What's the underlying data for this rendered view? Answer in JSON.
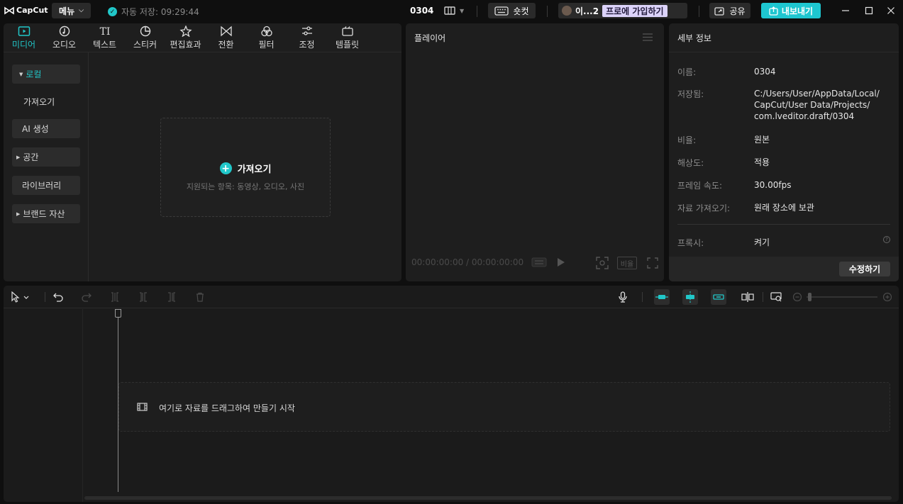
{
  "app": {
    "logo": "CapCut",
    "menu_label": "메뉴",
    "autosave": "자동 저장: 09:29:44",
    "project_name": "0304"
  },
  "titlebar": {
    "shortcut_label": "숏컷",
    "user_label": "이...2",
    "pro_label": "프로에 가입하기",
    "share_label": "공유",
    "export_label": "내보내기"
  },
  "tabs": [
    {
      "label": "미디어",
      "icon": "media-icon"
    },
    {
      "label": "오디오",
      "icon": "audio-icon"
    },
    {
      "label": "텍스트",
      "icon": "text-icon"
    },
    {
      "label": "스티커",
      "icon": "sticker-icon"
    },
    {
      "label": "편집효과",
      "icon": "effects-icon"
    },
    {
      "label": "전환",
      "icon": "transition-icon"
    },
    {
      "label": "필터",
      "icon": "filter-icon"
    },
    {
      "label": "조정",
      "icon": "adjust-icon"
    },
    {
      "label": "템플릿",
      "icon": "template-icon"
    }
  ],
  "sidebar": {
    "items": [
      {
        "label": "로컬"
      },
      {
        "label": "가져오기"
      },
      {
        "label": "AI 생성"
      },
      {
        "label": "공간"
      },
      {
        "label": "라이브러리"
      },
      {
        "label": "브랜드 자산"
      }
    ]
  },
  "import": {
    "title": "가져오기",
    "subtitle": "지원되는 항목: 동영상, 오디오, 사진"
  },
  "player": {
    "title": "플레이어",
    "timecode": "00:00:00:00 / 00:00:00:00",
    "ratio_label": "비율"
  },
  "details": {
    "title": "세부 정보",
    "rows": [
      {
        "label": "이름:",
        "value": "0304"
      },
      {
        "label": "저장됨:",
        "value": "C:/Users/User/AppData/Local/"
      },
      {
        "label": "",
        "value": "CapCut/User Data/Projects/"
      },
      {
        "label": "",
        "value": "com.lveditor.draft/0304"
      },
      {
        "label": "비율:",
        "value": "원본"
      },
      {
        "label": "해상도:",
        "value": "적용"
      },
      {
        "label": "프레임 속도:",
        "value": "30.00fps"
      },
      {
        "label": "자료 가져오기:",
        "value": "원래 장소에 보관"
      },
      {
        "label": "프록시:",
        "value": "켜기"
      }
    ],
    "edit_label": "수정하기"
  },
  "timeline": {
    "drop_text": "여기로 자료를 드래그하여 만들기 시작"
  },
  "colors": {
    "accent": "#21c7c9",
    "panel": "#1e1e1e",
    "background": "#0f0f0f",
    "pro": "#dcd3fa"
  }
}
